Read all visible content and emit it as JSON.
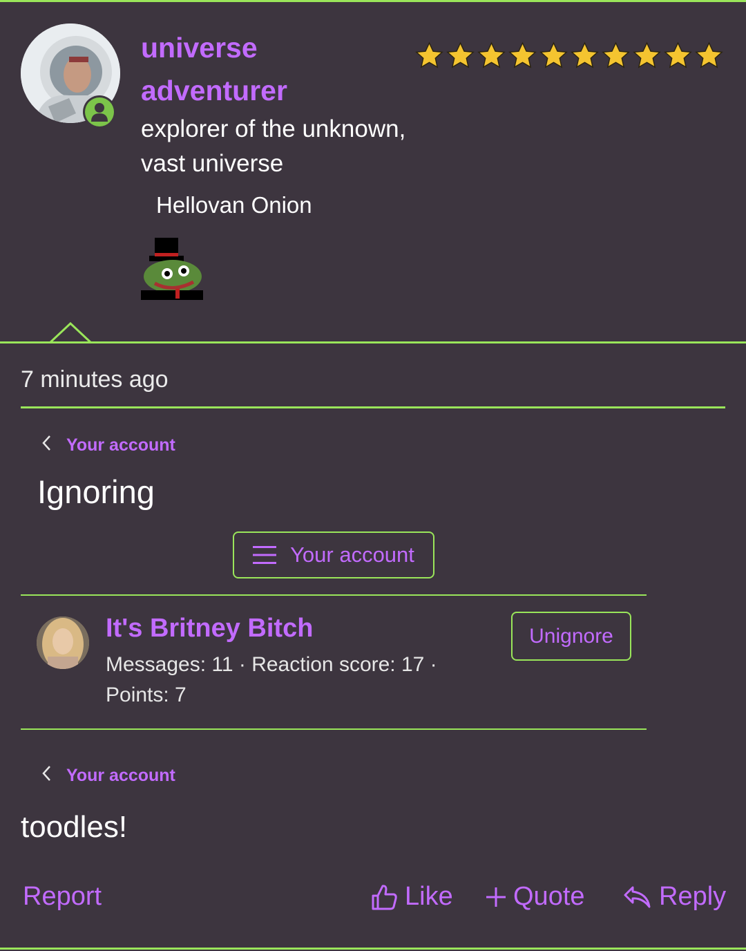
{
  "colors": {
    "background": "#3d353f",
    "accent_line": "#9ae65a",
    "link": "#c26bff",
    "star": "#f4c430",
    "online": "#7cc44a"
  },
  "user": {
    "name": "universe adventurer",
    "title": "explorer of the unknown, vast universe",
    "banner": "Hellovan Onion",
    "rating_stars": 10
  },
  "post": {
    "timestamp": "7 minutes ago",
    "breadcrumb_label": "Your account",
    "page_heading": "Ignoring",
    "menu_button_label": "Your account",
    "ignored_member": {
      "name": "It's Britney Bitch",
      "meta": "Messages: 11 · Reaction score: 17 · Points: 7",
      "unignore_label": "Unignore"
    },
    "breadcrumb_label_2": "Your account",
    "body_text": "toodles!"
  },
  "actions": {
    "report": "Report",
    "like": "Like",
    "quote": "Quote",
    "reply": "Reply"
  },
  "icons": [
    "online-status-icon",
    "star-icon",
    "chevron-left-icon",
    "menu-icon",
    "thumbs-up-icon",
    "plus-icon",
    "reply-icon"
  ]
}
